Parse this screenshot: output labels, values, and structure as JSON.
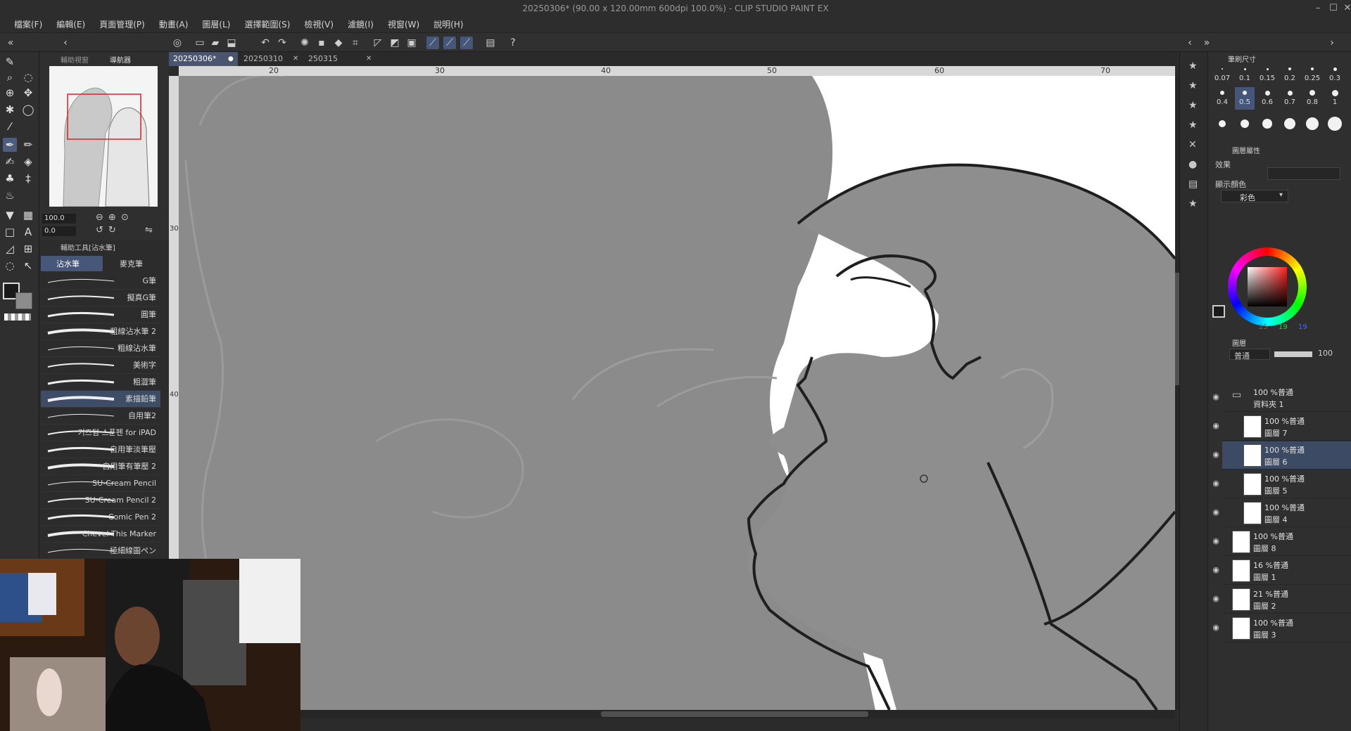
{
  "window": {
    "title": "20250306* (90.00 x 120.00mm 600dpi 100.0%)  - CLIP STUDIO PAINT EX",
    "min": "–",
    "max": "☐",
    "close": "✕"
  },
  "menu": [
    "檔案(F)",
    "編輯(E)",
    "頁面管理(P)",
    "動畫(A)",
    "圖層(L)",
    "選擇範圍(S)",
    "檢視(V)",
    "濾鏡(I)",
    "視窗(W)",
    "說明(H)"
  ],
  "navigator": {
    "tab1": "輔助視窗",
    "tab2": "導航器",
    "zoom": "100.0",
    "angle": "0.0"
  },
  "subtool": {
    "header": "輔助工具[沾水筆]",
    "tab_active": "沾水筆",
    "tab_other": "麥克筆",
    "brushes": [
      "G筆",
      "擬真G筆",
      "圓筆",
      "粗線沾水筆 2",
      "粗線沾水筆",
      "美術字",
      "粗澀筆",
      "素描鉛筆",
      "自用筆2",
      "커즈텀 스푼펜 for iPAD",
      "自用筆淡筆壓",
      "自用筆有筆壓 2",
      "SU-Cream Pencil",
      "SU-Cream Pencil 2",
      "Comic Pen 2",
      "Chevel This Marker",
      "極細線圖ペン"
    ],
    "selected_index": 7
  },
  "tabs": [
    {
      "label": "20250306*",
      "active": true
    },
    {
      "label": "20250310",
      "active": false
    },
    {
      "label": "250315",
      "active": false
    }
  ],
  "ruler": {
    "top": [
      "20",
      "30",
      "40",
      "50",
      "60",
      "70"
    ],
    "left": [
      "30",
      "40"
    ]
  },
  "brush_size": {
    "header": "筆刷尺寸",
    "sizes": [
      "0.07",
      "0.1",
      "0.15",
      "0.2",
      "0.25",
      "0.3",
      "0.4",
      "0.5",
      "0.6",
      "0.7",
      "0.8",
      "1"
    ],
    "selected": "0.5"
  },
  "layer_property": {
    "header": "圖層屬性",
    "effect_label": "效果",
    "display_color_label": "顯示顏色",
    "display_color_value": "彩色"
  },
  "color": {
    "r": "25",
    "g": "19",
    "b": "19"
  },
  "layers_panel": {
    "tab": "圖層",
    "blend": "普通",
    "opacity": "100",
    "layers": [
      {
        "line1": "100 %普通",
        "line2": "資料夾 1",
        "folder": true
      },
      {
        "line1": "100 %普通",
        "line2": "圖層 7"
      },
      {
        "line1": "100 %普通",
        "line2": "圖層 6",
        "selected": true
      },
      {
        "line1": "100 %普通",
        "line2": "圖層 5"
      },
      {
        "line1": "100 %普通",
        "line2": "圖層 4"
      },
      {
        "line1": "100 %普通",
        "line2": "圖層 8"
      },
      {
        "line1": "16 %普通",
        "line2": "圖層 1"
      },
      {
        "line1": "21 %普通",
        "line2": "圖層 2"
      },
      {
        "line1": "100 %普通",
        "line2": "圖層 3"
      }
    ]
  }
}
